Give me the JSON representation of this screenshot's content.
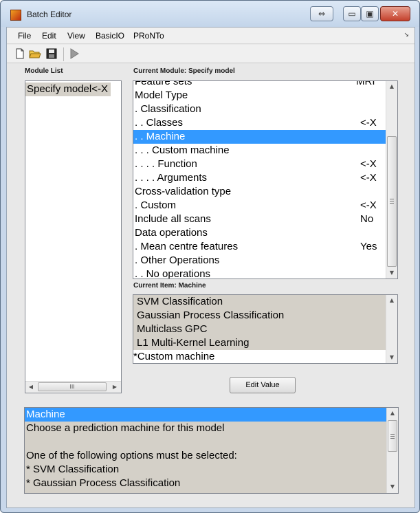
{
  "window": {
    "title": "Batch Editor",
    "controls": {
      "minimize": "▭",
      "restore": "▣",
      "close": "✕",
      "extra": "⇔"
    }
  },
  "menu": [
    "File",
    "Edit",
    "View",
    "BasicIO",
    "PRoNTo"
  ],
  "menu_overflow": "↘",
  "toolbar": {
    "icons": [
      "new-file-icon",
      "open-folder-icon",
      "save-disk-icon",
      "run-play-icon"
    ]
  },
  "module_list": {
    "label": "Module List",
    "items": [
      "Specify model<-X"
    ],
    "hscroll_grip": "III"
  },
  "current_module": {
    "label": "Current Module: Specify model",
    "partial_top": {
      "label": "Feature sets",
      "value": "MRI"
    },
    "items": [
      {
        "label": "Model Type",
        "value": ""
      },
      {
        "label": " . Classification",
        "value": ""
      },
      {
        "label": " . . Classes",
        "value": "<-X"
      },
      {
        "label": " . . Machine",
        "value": ""
      },
      {
        "label": " . . . Custom machine",
        "value": ""
      },
      {
        "label": " . . . . Function",
        "value": "<-X"
      },
      {
        "label": " . . . . Arguments",
        "value": "<-X"
      },
      {
        "label": "Cross-validation type",
        "value": ""
      },
      {
        "label": " . Custom",
        "value": "<-X"
      },
      {
        "label": "Include all scans",
        "value": "No"
      },
      {
        "label": "Data operations",
        "value": ""
      },
      {
        "label": " . Mean centre features",
        "value": "Yes"
      },
      {
        "label": " . Other Operations",
        "value": ""
      },
      {
        "label": " . . No operations",
        "value": ""
      }
    ],
    "selected_index": 3
  },
  "current_item": {
    "label": "Current Item: Machine",
    "options": [
      "SVM Classification",
      "Gaussian Process Classification",
      "Multiclass GPC",
      "L1 Multi-Kernel Learning",
      "*Custom machine"
    ],
    "selected_index": 4
  },
  "edit_button": {
    "label": "Edit Value"
  },
  "help": {
    "lines": [
      "Machine",
      "Choose a prediction machine for this model",
      "",
      "One of the following options must be selected:",
      "* SVM Classification",
      "* Gaussian Process Classification"
    ]
  },
  "colors": {
    "selection": "#3399ff",
    "gray_bg": "#d4d0c8"
  }
}
